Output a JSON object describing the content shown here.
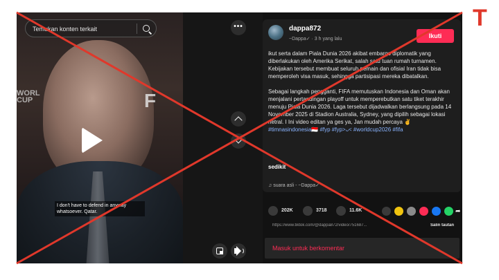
{
  "search": {
    "placeholder": "Temukan konten terkait"
  },
  "video": {
    "bg_text": "WORL\nCUP",
    "bg_logo": "F",
    "subtitle": "I don't have to defend in anyway whatsoever. Qatar.",
    "controls": {
      "more": "•••"
    }
  },
  "post": {
    "username": "dappa872",
    "meta": "~Dappa✓ · 3 h yang lalu",
    "follow_label": "Ikuti",
    "caption_1": "ikut serta dalam Piala Dunia 2026 akibat embargo diplomatik yang diberlakukan oleh Amerika Serikat, salah satu tuan rumah turnamen. Kebijakan tersebut membuat seluruh pemain dan ofisial Iran tidak bisa memperoleh visa masuk, sehingga partisipasi mereka dibatalkan.",
    "caption_2": "Sebagai langkah pengganti, FIFA memutuskan Indonesia dan Oman akan menjalani pertandingan playoff untuk memperebutkan satu tiket terakhir menuju Piala Dunia 2026. Laga tersebut dijadwalkan berlangsung pada 14 November 2025 di Stadion Australia, Sydney, yang dipilih sebagai lokasi netral. I Ini video editan ya ges ya, Jan mudah percaya ✌️",
    "hashtags": "#timnasindonesia🇮🇩 #fyp #fyp>ᴗ< #worldcup2026 #fifa",
    "see_more": "sedikit",
    "music": "♫  suara asli - ~Dappa✓"
  },
  "actions": {
    "likes": "202K",
    "comments": "3718",
    "saves": "11.6K"
  },
  "link": {
    "url": "https://www.tiktok.com/@dappa872/video/751687...",
    "copy_label": "Salin tautan"
  },
  "comment": {
    "login_prompt": "Masuk untuk berkomentar"
  },
  "overlay": {
    "stamp": "T",
    "x_color": "#e0382b"
  }
}
